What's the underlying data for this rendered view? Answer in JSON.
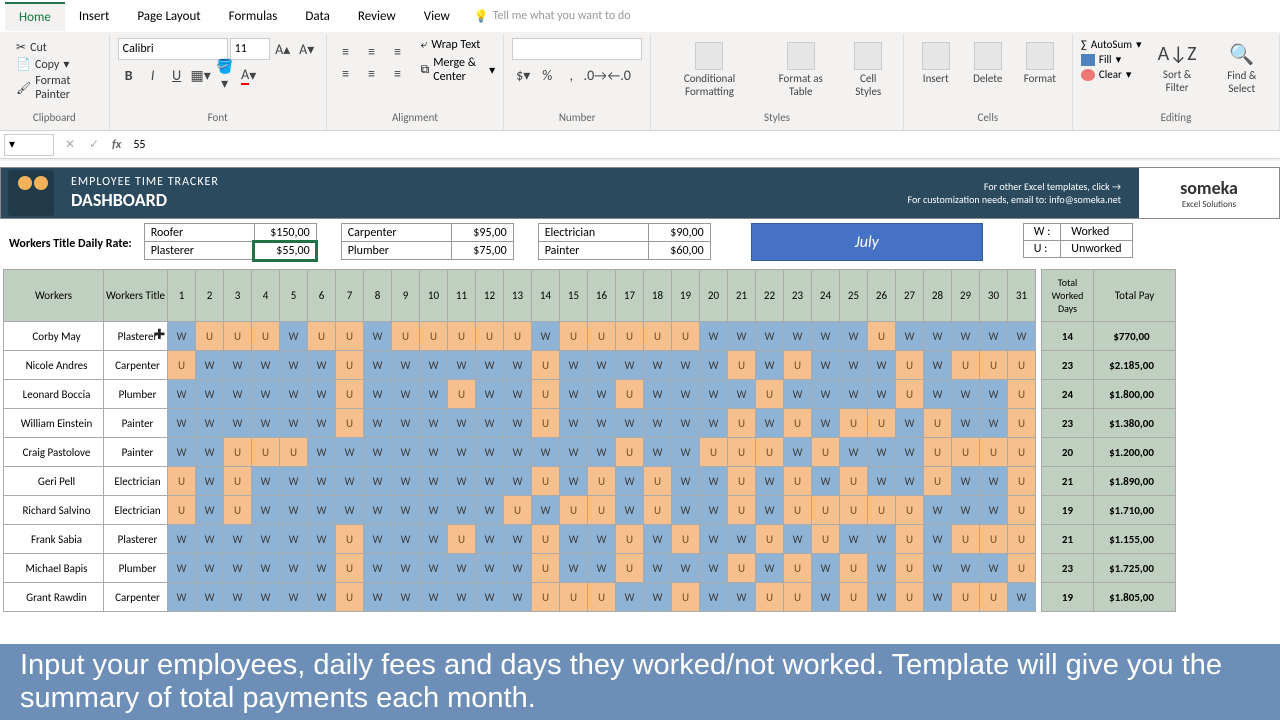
{
  "ribbon": {
    "tabs": [
      "Home",
      "Insert",
      "Page Layout",
      "Formulas",
      "Data",
      "Review",
      "View"
    ],
    "active_tab": "Home",
    "tellme_placeholder": "Tell me what you want to do",
    "clipboard": {
      "cut": "Cut",
      "copy": "Copy",
      "format_painter": "Format Painter",
      "group": "Clipboard"
    },
    "font": {
      "name": "Calibri",
      "size": "11",
      "group": "Font"
    },
    "alignment": {
      "wrap": "Wrap Text",
      "merge": "Merge & Center",
      "group": "Alignment"
    },
    "number": {
      "group": "Number"
    },
    "styles": {
      "cond": "Conditional Formatting",
      "table": "Format as Table",
      "cell": "Cell Styles",
      "group": "Styles"
    },
    "cells": {
      "insert": "Insert",
      "delete": "Delete",
      "format": "Format",
      "group": "Cells"
    },
    "editing": {
      "autosum": "AutoSum",
      "fill": "Fill",
      "clear": "Clear",
      "sort": "Sort & Filter",
      "find": "Find & Select",
      "group": "Editing"
    }
  },
  "formula_bar": {
    "value": "55"
  },
  "dashboard": {
    "title_1": "EMPLOYEE TIME TRACKER",
    "title_2": "DASHBOARD",
    "tip": "For other Excel templates, click →",
    "email": "For customization needs, email to: info@someka.net",
    "brand_name": "someka",
    "brand_sub": "Excel Solutions"
  },
  "rates": {
    "label": "Workers Title Daily Rate:",
    "pairs": [
      [
        {
          "name": "Roofer",
          "value": "$150,00"
        },
        {
          "name": "Carpenter",
          "value": "$95,00"
        },
        {
          "name": "Electrician",
          "value": "$90,00"
        }
      ],
      [
        {
          "name": "Plasterer",
          "value": "$55,00"
        },
        {
          "name": "Plumber",
          "value": "$75,00"
        },
        {
          "name": "Painter",
          "value": "$60,00"
        }
      ]
    ],
    "selected_cell": "$55,00"
  },
  "month": "July",
  "legend": {
    "W_key": "W :",
    "W_val": "Worked",
    "U_key": "U :",
    "U_val": "Unworked"
  },
  "columns": {
    "workers": "Workers",
    "title": "Workers Title",
    "total_days": "Total Worked Days",
    "total_pay": "Total Pay",
    "days": [
      "1",
      "2",
      "3",
      "4",
      "5",
      "6",
      "7",
      "8",
      "9",
      "10",
      "11",
      "12",
      "13",
      "14",
      "15",
      "16",
      "17",
      "18",
      "19",
      "20",
      "21",
      "22",
      "23",
      "24",
      "25",
      "26",
      "27",
      "28",
      "29",
      "30",
      "31"
    ]
  },
  "rows": [
    {
      "name": "Corby May",
      "title": "Plasterer",
      "days": [
        "W",
        "U",
        "U",
        "U",
        "W",
        "U",
        "U",
        "W",
        "U",
        "U",
        "U",
        "U",
        "U",
        "W",
        "U",
        "U",
        "U",
        "U",
        "U",
        "W",
        "W",
        "W",
        "W",
        "W",
        "W",
        "U",
        "W",
        "W",
        "W",
        "W",
        "W"
      ],
      "worked": "14",
      "pay": "$770,00"
    },
    {
      "name": "Nicole Andres",
      "title": "Carpenter",
      "days": [
        "U",
        "W",
        "W",
        "W",
        "W",
        "W",
        "U",
        "W",
        "W",
        "W",
        "W",
        "W",
        "W",
        "U",
        "W",
        "W",
        "W",
        "W",
        "W",
        "W",
        "U",
        "W",
        "U",
        "W",
        "W",
        "W",
        "U",
        "W",
        "U",
        "U",
        "U"
      ],
      "worked": "23",
      "pay": "$2.185,00"
    },
    {
      "name": "Leonard Boccia",
      "title": "Plumber",
      "days": [
        "W",
        "W",
        "W",
        "W",
        "W",
        "W",
        "U",
        "W",
        "W",
        "W",
        "U",
        "W",
        "W",
        "U",
        "W",
        "W",
        "U",
        "W",
        "W",
        "W",
        "W",
        "U",
        "W",
        "W",
        "W",
        "W",
        "U",
        "W",
        "W",
        "W",
        "U"
      ],
      "worked": "24",
      "pay": "$1.800,00"
    },
    {
      "name": "William Einstein",
      "title": "Painter",
      "days": [
        "W",
        "W",
        "W",
        "W",
        "W",
        "W",
        "U",
        "W",
        "W",
        "W",
        "W",
        "W",
        "W",
        "U",
        "W",
        "W",
        "W",
        "W",
        "W",
        "W",
        "U",
        "W",
        "U",
        "W",
        "U",
        "U",
        "W",
        "U",
        "W",
        "W",
        "U"
      ],
      "worked": "23",
      "pay": "$1.380,00"
    },
    {
      "name": "Craig Pastolove",
      "title": "Painter",
      "days": [
        "W",
        "W",
        "U",
        "U",
        "U",
        "W",
        "W",
        "W",
        "W",
        "W",
        "W",
        "W",
        "W",
        "W",
        "W",
        "W",
        "U",
        "W",
        "W",
        "U",
        "U",
        "U",
        "W",
        "U",
        "W",
        "W",
        "W",
        "U",
        "U",
        "U",
        "U"
      ],
      "worked": "20",
      "pay": "$1.200,00"
    },
    {
      "name": "Geri Pell",
      "title": "Electrician",
      "days": [
        "U",
        "W",
        "U",
        "W",
        "W",
        "W",
        "W",
        "W",
        "W",
        "W",
        "W",
        "W",
        "W",
        "U",
        "W",
        "U",
        "W",
        "U",
        "W",
        "W",
        "U",
        "W",
        "U",
        "W",
        "U",
        "W",
        "W",
        "U",
        "W",
        "W",
        "U"
      ],
      "worked": "21",
      "pay": "$1.890,00"
    },
    {
      "name": "Richard Salvino",
      "title": "Electrician",
      "days": [
        "U",
        "W",
        "U",
        "W",
        "W",
        "W",
        "W",
        "W",
        "W",
        "W",
        "W",
        "W",
        "U",
        "W",
        "U",
        "U",
        "W",
        "U",
        "W",
        "W",
        "U",
        "W",
        "U",
        "U",
        "U",
        "U",
        "U",
        "W",
        "W",
        "W",
        "U"
      ],
      "worked": "19",
      "pay": "$1.710,00"
    },
    {
      "name": "Frank Sabia",
      "title": "Plasterer",
      "days": [
        "W",
        "W",
        "W",
        "W",
        "W",
        "W",
        "U",
        "W",
        "W",
        "W",
        "U",
        "W",
        "W",
        "U",
        "W",
        "W",
        "U",
        "W",
        "U",
        "W",
        "W",
        "U",
        "W",
        "U",
        "W",
        "W",
        "U",
        "W",
        "U",
        "U",
        "U"
      ],
      "worked": "21",
      "pay": "$1.155,00"
    },
    {
      "name": "Michael Bapis",
      "title": "Plumber",
      "days": [
        "W",
        "W",
        "W",
        "W",
        "W",
        "W",
        "U",
        "W",
        "W",
        "W",
        "W",
        "W",
        "W",
        "U",
        "W",
        "W",
        "U",
        "W",
        "W",
        "W",
        "U",
        "W",
        "U",
        "W",
        "U",
        "W",
        "U",
        "W",
        "W",
        "W",
        "U"
      ],
      "worked": "23",
      "pay": "$1.725,00"
    },
    {
      "name": "Grant Rawdin",
      "title": "Carpenter",
      "days": [
        "W",
        "W",
        "W",
        "W",
        "W",
        "W",
        "U",
        "W",
        "W",
        "W",
        "W",
        "W",
        "W",
        "U",
        "U",
        "U",
        "W",
        "W",
        "U",
        "W",
        "W",
        "U",
        "U",
        "W",
        "U",
        "W",
        "U",
        "W",
        "U",
        "U",
        "W"
      ],
      "worked": "19",
      "pay": "$1.805,00"
    }
  ],
  "caption": "Input your employees, daily fees and days they worked/not worked. Template will give you the summary of total payments each month."
}
